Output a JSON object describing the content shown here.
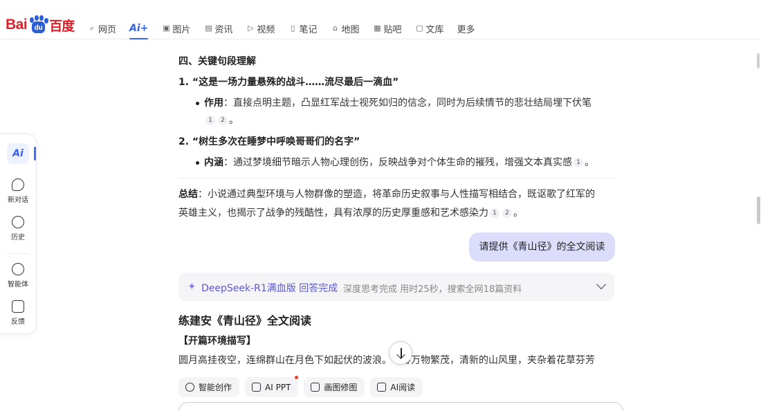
{
  "header": {
    "logo_text_left": "Bai",
    "logo_text_paw": "du",
    "logo_text_right": "百度",
    "nav": [
      {
        "label": "网页",
        "icon": "search-icon"
      },
      {
        "label": "Ai+",
        "icon": "",
        "active": true
      },
      {
        "label": "图片",
        "icon": "image-icon"
      },
      {
        "label": "资讯",
        "icon": "news-icon"
      },
      {
        "label": "视频",
        "icon": "video-icon"
      },
      {
        "label": "笔记",
        "icon": "note-icon"
      },
      {
        "label": "地图",
        "icon": "map-icon"
      },
      {
        "label": "贴吧",
        "icon": "tieba-icon"
      },
      {
        "label": "文库",
        "icon": "doc-icon"
      },
      {
        "label": "更多",
        "icon": ""
      }
    ]
  },
  "sidebar": {
    "ai_label": "Ai",
    "items": [
      {
        "label": "新对话",
        "icon": "new-chat-icon"
      },
      {
        "label": "历史",
        "icon": "history-icon"
      },
      {
        "label": "智能体",
        "icon": "agent-icon"
      },
      {
        "label": "反馈",
        "icon": "feedback-icon"
      }
    ]
  },
  "answer": {
    "section_title": "四、关键句段理解",
    "q1": "1. “这是一场力量悬殊的战斗……流尽最后一滴血”",
    "q1_bullet_label": "作用",
    "q1_bullet_text": "：直接点明主题，凸显红军战士视死如归的信念，同时为后续情节的悲壮结局埋下伏笔",
    "q1_cites": [
      "1",
      "2"
    ],
    "q1_end": "。",
    "q2": "2. “树生多次在睡梦中呼唤哥哥们的名字”",
    "q2_bullet_label": "内涵",
    "q2_bullet_text": "：通过梦境细节暗示人物心理创伤，反映战争对个体生命的摧残，增强文本真实感",
    "q2_cites": [
      "1"
    ],
    "q2_end": "。",
    "summary_label": "总结",
    "summary_line1": "：小说通过典型环境与人物群像的塑造，将革命历史叙事与人性描写相结合，既讴歌了红军的",
    "summary_line2": "英雄主义，也揭示了战争的残酷性，具有浓厚的历史厚重感和艺术感染力",
    "summary_cites": [
      "1",
      "2"
    ],
    "summary_end": "。"
  },
  "user_message": "请提供《青山径》的全文阅读",
  "thinking": {
    "model_status": "DeepSeek-R1满血版 回答完成",
    "detail": "深度思考完成 用时25秒，搜索全网18篇资料"
  },
  "answer2": {
    "title": "练建安《青山径》全文阅读",
    "subtitle": "【开篇环境描写】",
    "para_visible": "圆月高挂夜空，连绵群山在月色下如起伏的波浪。",
    "para_hidden_tail": "春万物繁茂，清新的山风里，夹杂着花草芬芳"
  },
  "tools": [
    {
      "label": "智能创作",
      "icon": "pen-icon",
      "dot": false
    },
    {
      "label": "AI PPT",
      "icon": "ppt-icon",
      "dot": true
    },
    {
      "label": "画图修图",
      "icon": "picture-edit-icon",
      "dot": false
    },
    {
      "label": "AI阅读",
      "icon": "book-icon",
      "dot": false
    }
  ],
  "colors": {
    "brand_red": "#de1f26",
    "brand_blue": "#2a5fd8",
    "accent": "#3560e8",
    "bubble": "#dcdcfb",
    "thinking_text": "#5b57d6"
  }
}
